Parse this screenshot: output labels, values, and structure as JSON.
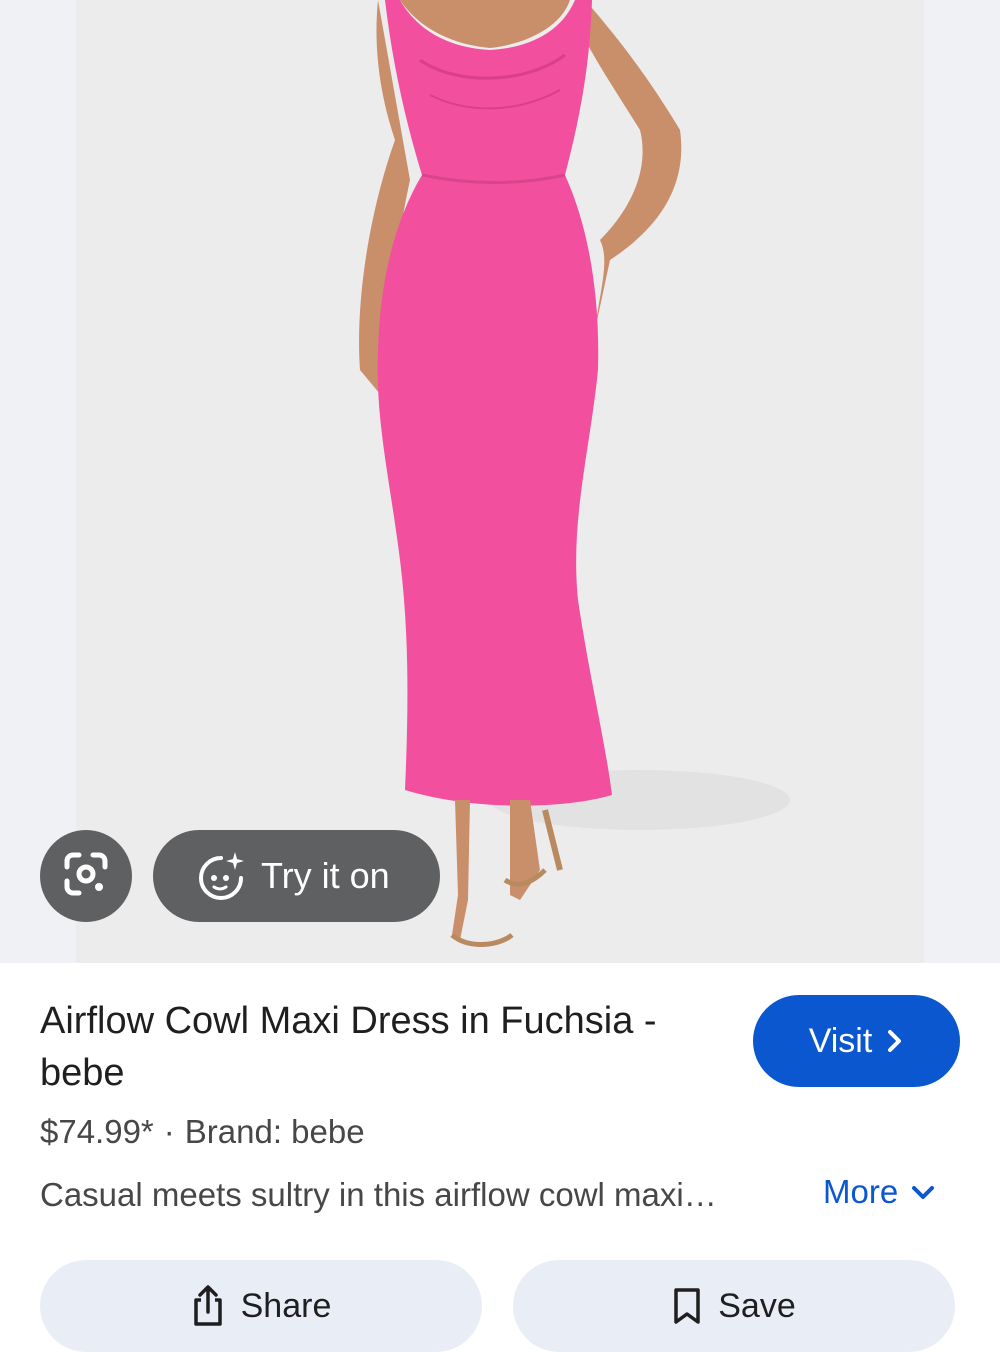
{
  "product_image": {
    "alt_label": "product-photo"
  },
  "overlay": {
    "try_on_label": "Try it on"
  },
  "product": {
    "title": "Airflow Cowl Maxi Dress in Fuchsia - bebe",
    "price": "$74.99*",
    "separator": "·",
    "brand": "Brand: bebe",
    "description": "Casual meets sultry in this airflow cowl maxi…"
  },
  "actions": {
    "visit_label": "Visit",
    "more_label": "More",
    "share_label": "Share",
    "save_label": "Save"
  },
  "colors": {
    "accent": "#0b57d0",
    "dress": "#f2509f",
    "overlay_button": "#5f6062",
    "action_button_bg": "#e9eef6"
  },
  "icons": {
    "lens": "camera-lens-icon",
    "try_on": "sparkle-face-icon",
    "visit_chevron": "chevron-right-icon",
    "more_chevron": "chevron-down-icon",
    "share": "share-icon",
    "save": "bookmark-icon"
  }
}
